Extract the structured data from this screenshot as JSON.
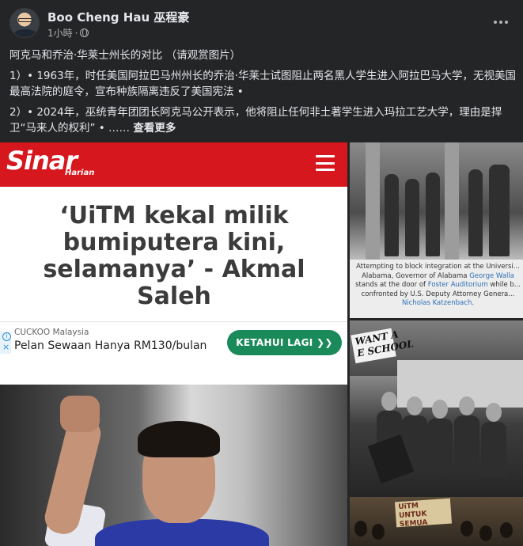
{
  "post": {
    "author": "Boo Cheng Hau 巫程豪",
    "time": "1小時",
    "paragraphs": [
      "阿克马和乔治·华莱士州长的对比 （请观赏图片）",
      "1）• 1963年，时任美国阿拉巴马州州长的乔治·华莱士试图阻止两名黑人学生进入阿拉巴马大学，无视美国最高法院的庭令，宣布种族隔离违反了美国宪法 •",
      "2）• 2024年，巫统青年团团长阿克马公开表示，他将阻止任何非土著学生进入玛拉工艺大学，理由是捍卫“马来人的权利” • ……"
    ],
    "see_more": "查看更多",
    "icons": {
      "privacy": "globe-icon",
      "menu": "more-options-icon"
    }
  },
  "sinar": {
    "logo": "Sinar",
    "logo_sub": "Harian",
    "headline": "‘UiTM kekal milik bumiputera kini, selamanya’ - Akmal Saleh",
    "ad": {
      "brand": "CUCKOO Malaysia",
      "text": "Pelan Sewaan Hanya RM130/bulan",
      "button": "KETAHUI LAGI ❯❯"
    },
    "brand_color": "#d6171e"
  },
  "history_photo": {
    "caption_before": "Attempting to block integration at the Universi... Alabama, Governor of Alabama ",
    "caption_link1": "George Walla",
    "caption_mid": " stands at the door of ",
    "caption_link2": "Foster Auditorium",
    "caption_mid2": " while b... confronted by U.S. Deputy Attorney Genera... ",
    "caption_link3": "Nicholas Katzenbach",
    "caption_end": "."
  },
  "protest_photo": {
    "sign": "WANT A\nE SCHOOL"
  },
  "protest_photo2": {
    "sign": "UiTM\nUNTUK\nSEMUA"
  }
}
